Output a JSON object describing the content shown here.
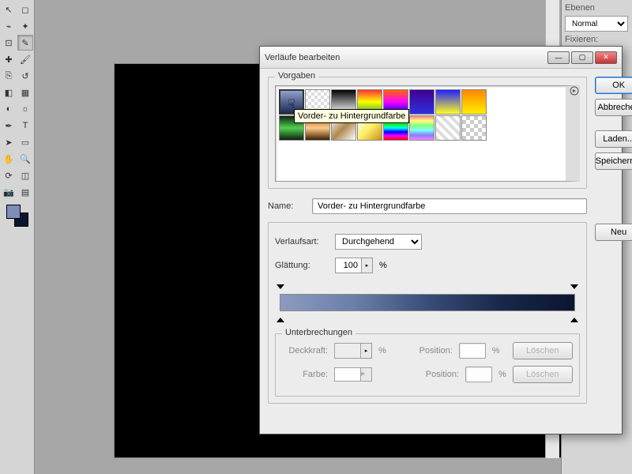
{
  "toolbar": {
    "tools": [
      "move-tool",
      "marquee-tool",
      "lasso-tool",
      "wand-tool",
      "crop-tool",
      "eyedropper-tool",
      "healing-tool",
      "brush-tool",
      "stamp-tool",
      "history-brush-tool",
      "eraser-tool",
      "gradient-tool",
      "blur-tool",
      "dodge-tool",
      "pen-tool",
      "type-tool",
      "path-select-tool",
      "shape-tool",
      "hand-tool",
      "zoom-tool",
      "rotate-tool",
      "3d-tool",
      "camera-tool",
      "grid-tool"
    ],
    "active_index": 5
  },
  "right_panel": {
    "layers_label": "Ebenen",
    "blend_mode": "Normal",
    "fix_label": "Fixieren:"
  },
  "dialog": {
    "title": "Verläufe bearbeiten",
    "buttons": {
      "ok": "OK",
      "cancel": "Abbrechen",
      "load": "Laden...",
      "save": "Speichern...",
      "new": "Neu"
    },
    "presets": {
      "label": "Vorgaben",
      "tooltip": "Vorder- zu Hintergrundfarbe",
      "items": [
        {
          "bg": "linear-gradient(#8fa2cb,#1a2a55)"
        },
        {
          "bg": "repeating-conic-gradient(#ddd 0 25%, #fff 0 50%) 50%/8px 8px"
        },
        {
          "bg": "linear-gradient(#000,#fff)"
        },
        {
          "bg": "linear-gradient(#f33,#ff0,#3a3)"
        },
        {
          "bg": "linear-gradient(#f60,#f0f,#00f)"
        },
        {
          "bg": "linear-gradient(#400090,#3030e0)"
        },
        {
          "bg": "linear-gradient(#2020ff,#ffff20)"
        },
        {
          "bg": "linear-gradient(#ff8800,#ffee00)"
        },
        {
          "bg": "linear-gradient(#102010,#50d050,#102010)"
        },
        {
          "bg": "linear-gradient(#b05020,#ffcc88,#402000)"
        },
        {
          "bg": "linear-gradient(135deg,#fff,#b08850,#fff)"
        },
        {
          "bg": "linear-gradient(135deg,#fff,#ffee66,#c89020)"
        },
        {
          "bg": "linear-gradient(#f00,#ff0,#0f0,#0ff,#00f,#f0f,#f00)"
        },
        {
          "bg": "linear-gradient(#ff8080,#ffff80,#80ff80,#80ffff,#8080ff,#ff80ff)"
        },
        {
          "bg": "repeating-linear-gradient(45deg,#ddd 0 4px,#fff 4px 8px)"
        },
        {
          "bg": "repeating-conic-gradient(#ccc 0 25%, #fff 0 50%) 50%/10px 10px"
        }
      ]
    },
    "name_label": "Name:",
    "name_value": "Vorder- zu Hintergrundfarbe",
    "type_label": "Verlaufsart:",
    "type_value": "Durchgehend",
    "smooth_label": "Glättung:",
    "smooth_value": "100",
    "stops": {
      "label": "Unterbrechungen",
      "opacity_label": "Deckkraft:",
      "position_label": "Position:",
      "color_label": "Farbe:",
      "delete": "Löschen"
    }
  }
}
